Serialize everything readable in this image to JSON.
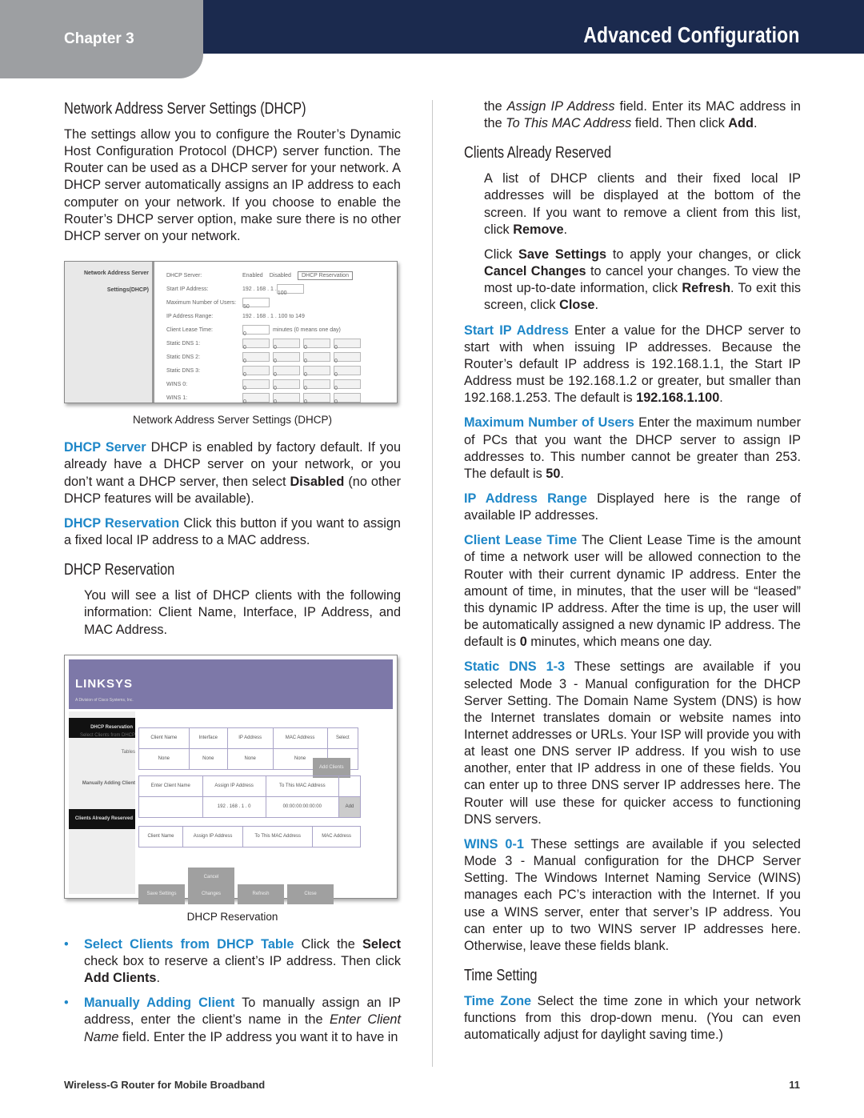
{
  "header": {
    "chapter": "Chapter 3",
    "title": "Advanced Configuration"
  },
  "footer": {
    "product": "Wireless-G Router for Mobile Broadband",
    "page": "11"
  },
  "left": {
    "heading1": "Network Address Server Settings (DHCP)",
    "intro": "The settings allow you to configure the Router’s Dynamic Host Configuration Protocol (DHCP) server function. The Router can be used as a DHCP server for your network. A DHCP server automatically assigns an IP address to each computer on your network. If you choose to enable the Router’s DHCP server option, make sure there is no other DHCP server on your network.",
    "fig1": {
      "caption": "Network Address Server Settings (DHCP)",
      "section": "Network Address Server Settings(DHCP)",
      "labels": [
        "DHCP Server:",
        "Start IP Address:",
        "Maximum Number of Users:",
        "IP Address Range:",
        "Client Lease Time:",
        "Static DNS 1:",
        "Static DNS 2:",
        "Static DNS 3:",
        "WINS 0:",
        "WINS 1:"
      ],
      "enabled": "Enabled",
      "disabled": "Disabled",
      "reservation_btn": "DHCP Reservation",
      "start_prefix": "192 . 168 . 1 .",
      "start_value": "100",
      "max_users": "50",
      "range": "192 . 168 . 1 . 100 to 149",
      "lease": "0",
      "lease_note": "minutes (0 means one day)",
      "ip_zero": "0"
    },
    "p_dhcp_server": [
      {
        "t": "DHCP Server",
        "s": "term"
      },
      {
        "t": "  DHCP is enabled by factory default. If you already have a DHCP server on your network, or you don’t want a DHCP server, then select "
      },
      {
        "t": "Disabled",
        "s": "b"
      },
      {
        "t": " (no other DHCP features will be available)."
      }
    ],
    "p_dhcp_res": [
      {
        "t": "DHCP Reservation",
        "s": "term"
      },
      {
        "t": "  Click this button if you want to assign a fixed local IP address to a MAC address."
      }
    ],
    "heading2": "DHCP Reservation",
    "p_res_intro": "You will see a list of DHCP clients with the following information: Client Name, Interface, IP Address, and MAC Address.",
    "fig2": {
      "caption": "DHCP Reservation",
      "logo": "LINKSYS",
      "logo_sub": "A Division of Cisco Systems, Inc.",
      "sec1": "DHCP Reservation",
      "sec1_sub": "Select Clients from DHCP Tables",
      "cols1": [
        "Client Name",
        "Interface",
        "IP Address",
        "MAC Address",
        "Select"
      ],
      "row1": [
        "None",
        "None",
        "None",
        "None",
        ""
      ],
      "add_clients": "Add Clients",
      "sec2": "Manually Adding Client",
      "cols2": [
        "Enter Client Name",
        "Assign IP Address",
        "To This MAC Address"
      ],
      "ip": "192 . 168 . 1 . 0",
      "mac": "00:00:00:00:00:00",
      "add": "Add",
      "sec3": "Clients Already Reserved",
      "cols3": [
        "Client Name",
        "Assign IP Address",
        "To This MAC Address",
        "MAC Address"
      ],
      "buttons": [
        "Save Settings",
        "Cancel Changes",
        "Refresh",
        "Close"
      ]
    },
    "bullets": [
      [
        {
          "t": "Select Clients from DHCP Table",
          "s": "term"
        },
        {
          "t": "  Click the "
        },
        {
          "t": "Select",
          "s": "b"
        },
        {
          "t": " check box to reserve a client’s IP address. Then click "
        },
        {
          "t": "Add Clients",
          "s": "b"
        },
        {
          "t": "."
        }
      ],
      [
        {
          "t": "Manually Adding Client",
          "s": "term"
        },
        {
          "t": "  To manually assign an IP address, enter the client’s name in the "
        },
        {
          "t": "Enter Client Name",
          "s": "i"
        },
        {
          "t": " field. Enter the IP address you want it to have in"
        }
      ]
    ]
  },
  "right": {
    "p_cont": [
      {
        "t": "the "
      },
      {
        "t": "Assign IP Address",
        "s": "i"
      },
      {
        "t": " field. Enter its MAC address in the "
      },
      {
        "t": "To This MAC Address",
        "s": "i"
      },
      {
        "t": " field. Then click "
      },
      {
        "t": "Add",
        "s": "b"
      },
      {
        "t": "."
      }
    ],
    "heading3": "Clients Already Reserved",
    "p_list": [
      {
        "t": "A list of DHCP clients and their fixed local IP addresses will be displayed at the bottom of the screen. If you want to remove a client from this list, click "
      },
      {
        "t": "Remove",
        "s": "b"
      },
      {
        "t": "."
      }
    ],
    "p_save": [
      {
        "t": "Click "
      },
      {
        "t": "Save Settings",
        "s": "b"
      },
      {
        "t": " to apply your changes, or click "
      },
      {
        "t": "Cancel Changes",
        "s": "b"
      },
      {
        "t": " to cancel your changes. To view the most up-to-date information, click "
      },
      {
        "t": "Refresh",
        "s": "b"
      },
      {
        "t": ". To exit this screen, click "
      },
      {
        "t": "Close",
        "s": "b"
      },
      {
        "t": "."
      }
    ],
    "p_start": [
      {
        "t": "Start IP Address",
        "s": "term"
      },
      {
        "t": "  Enter a value for the DHCP server to start with when issuing IP addresses. Because the Router’s default IP address is 192.168.1.1, the Start IP Address must be 192.168.1.2 or greater, but smaller than 192.168.1.253. The default is "
      },
      {
        "t": "192.168.1.100",
        "s": "b"
      },
      {
        "t": "."
      }
    ],
    "p_max": [
      {
        "t": "Maximum Number of Users",
        "s": "term"
      },
      {
        "t": "  Enter the maximum number of PCs that you want the DHCP server to assign IP addresses to. This number cannot be greater than 253. The default is "
      },
      {
        "t": "50",
        "s": "b"
      },
      {
        "t": "."
      }
    ],
    "p_range": [
      {
        "t": "IP Address Range",
        "s": "term"
      },
      {
        "t": "  Displayed here is the range of available IP addresses."
      }
    ],
    "p_lease": [
      {
        "t": "Client Lease Time",
        "s": "term"
      },
      {
        "t": "  The Client Lease Time is the amount of time a network user will be allowed connection to the Router with their current dynamic IP address. Enter the amount of time, in minutes, that the user will be “leased” this dynamic IP address. After the time is up, the user will be automatically assigned a new dynamic IP address. The default is "
      },
      {
        "t": "0",
        "s": "b"
      },
      {
        "t": " minutes, which means one day."
      }
    ],
    "p_dns": [
      {
        "t": "Static DNS 1-3",
        "s": "term"
      },
      {
        "t": "  These settings are available if you selected Mode 3 - Manual configuration for the DHCP Server Setting. The Domain Name System (DNS) is how the Internet translates domain or website names into Internet addresses or URLs. Your ISP will provide you with at least one DNS server IP address. If you wish to use another, enter that IP address in one of these fields. You can enter up to three DNS server IP addresses here. The Router will use these for quicker access to functioning DNS servers."
      }
    ],
    "p_wins": [
      {
        "t": "WINS 0-1",
        "s": "term"
      },
      {
        "t": "  These settings are available if you selected Mode 3 - Manual configuration for the DHCP Server Setting. The Windows Internet Naming Service (WINS) manages each PC’s interaction with the Internet. If you use a WINS server, enter that server’s IP address. You can enter up to two WINS server IP addresses here. Otherwise, leave these fields blank."
      }
    ],
    "heading4": "Time Setting",
    "p_tz": [
      {
        "t": "Time Zone",
        "s": "term"
      },
      {
        "t": "  Select the time zone in which your network functions from this drop-down menu. (You can even automatically adjust for daylight saving time.)"
      }
    ]
  },
  "colors": {
    "header_bg": "#1b2a4e",
    "tab_bg": "#9d9fa2",
    "term": "#1e87c8",
    "linksys_banner": "#7d78a8"
  }
}
